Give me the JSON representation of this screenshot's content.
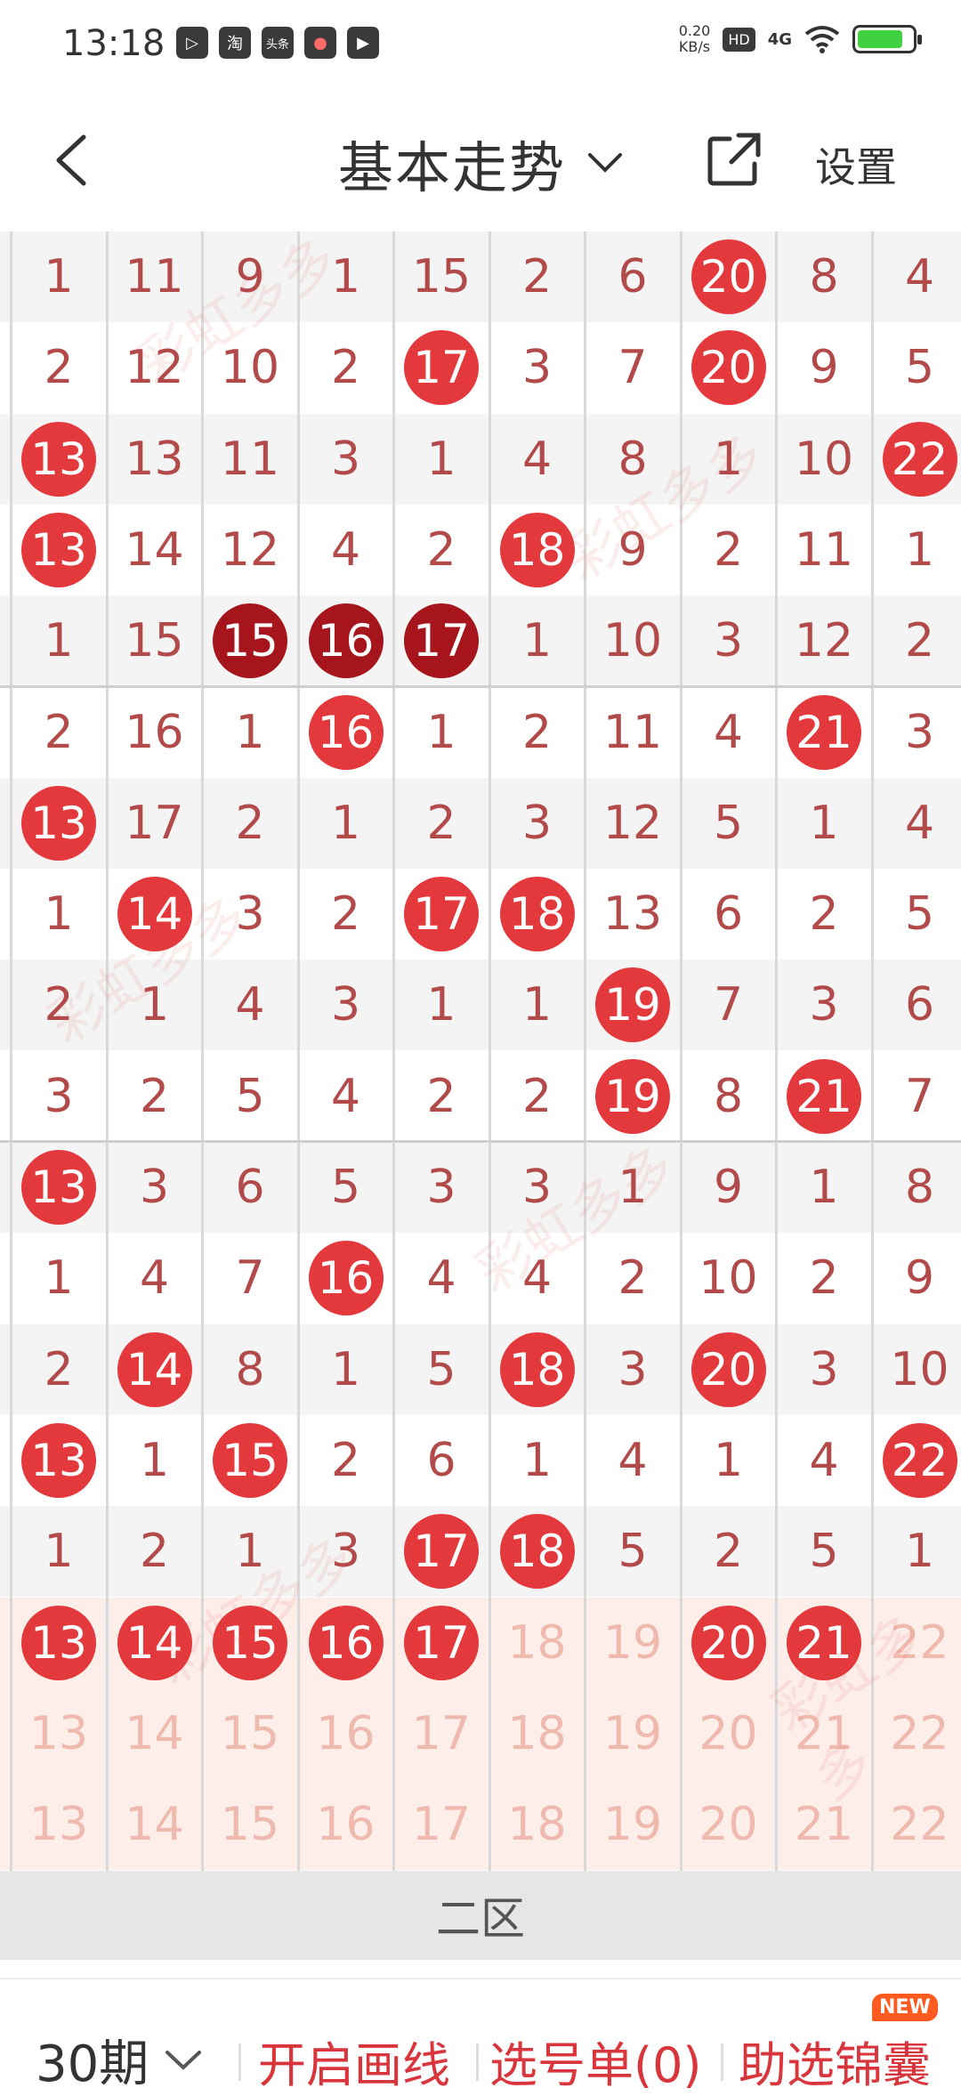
{
  "status_bar": {
    "time": "13:18",
    "apps": [
      "▷",
      "淘",
      "头条",
      "●",
      "▶"
    ],
    "net_speed": "0.20",
    "net_speed_unit": "KB/s",
    "hd_label": "HD",
    "network": "4G",
    "battery_level": 0.8,
    "battery_color": "#3fd13f"
  },
  "header": {
    "title": "基本走势",
    "settings_label": "设置"
  },
  "grid": {
    "partial_left_column": true,
    "rows": [
      {
        "cells": [
          "1",
          "11",
          "9",
          "1",
          "15",
          "2",
          "6",
          "20",
          "8",
          "4"
        ],
        "balls": [
          7
        ]
      },
      {
        "cells": [
          "2",
          "12",
          "10",
          "2",
          "17",
          "3",
          "7",
          "20",
          "9",
          "5"
        ],
        "balls": [
          4,
          7
        ]
      },
      {
        "cells": [
          "13",
          "13",
          "11",
          "3",
          "1",
          "4",
          "8",
          "1",
          "10",
          "22"
        ],
        "balls": [
          0,
          9
        ]
      },
      {
        "cells": [
          "13",
          "14",
          "12",
          "4",
          "2",
          "18",
          "9",
          "2",
          "11",
          "1"
        ],
        "balls": [
          0,
          5
        ]
      },
      {
        "cells": [
          "1",
          "15",
          "15",
          "16",
          "17",
          "1",
          "10",
          "3",
          "12",
          "2"
        ],
        "dark_balls": [
          2,
          3,
          4
        ]
      },
      {
        "cells": [
          "2",
          "16",
          "1",
          "16",
          "1",
          "2",
          "11",
          "4",
          "21",
          "3"
        ],
        "balls": [
          3,
          8
        ]
      },
      {
        "cells": [
          "13",
          "17",
          "2",
          "1",
          "2",
          "3",
          "12",
          "5",
          "1",
          "4"
        ],
        "balls": [
          0
        ]
      },
      {
        "cells": [
          "1",
          "14",
          "3",
          "2",
          "17",
          "18",
          "13",
          "6",
          "2",
          "5"
        ],
        "balls": [
          1,
          4,
          5
        ]
      },
      {
        "cells": [
          "2",
          "1",
          "4",
          "3",
          "1",
          "1",
          "19",
          "7",
          "3",
          "6"
        ],
        "balls": [
          6
        ]
      },
      {
        "cells": [
          "3",
          "2",
          "5",
          "4",
          "2",
          "2",
          "19",
          "8",
          "21",
          "7"
        ],
        "balls": [
          6,
          8
        ]
      },
      {
        "cells": [
          "13",
          "3",
          "6",
          "5",
          "3",
          "3",
          "1",
          "9",
          "1",
          "8"
        ],
        "balls": [
          0
        ]
      },
      {
        "cells": [
          "1",
          "4",
          "7",
          "16",
          "4",
          "4",
          "2",
          "10",
          "2",
          "9"
        ],
        "balls": [
          3
        ]
      },
      {
        "cells": [
          "2",
          "14",
          "8",
          "1",
          "5",
          "18",
          "3",
          "20",
          "3",
          "10"
        ],
        "balls": [
          1,
          5,
          7
        ]
      },
      {
        "cells": [
          "13",
          "1",
          "15",
          "2",
          "6",
          "1",
          "4",
          "1",
          "4",
          "22"
        ],
        "balls": [
          0,
          2,
          9
        ]
      },
      {
        "cells": [
          "1",
          "2",
          "1",
          "3",
          "17",
          "18",
          "5",
          "2",
          "5",
          "1"
        ],
        "balls": [
          4,
          5
        ]
      },
      {
        "cells": [
          "13",
          "14",
          "15",
          "16",
          "17",
          "18",
          "19",
          "20",
          "21",
          "22"
        ],
        "balls": [
          0,
          1,
          2,
          3,
          4,
          7,
          8
        ],
        "pale": true
      },
      {
        "cells": [
          "13",
          "14",
          "15",
          "16",
          "17",
          "18",
          "19",
          "20",
          "21",
          "22"
        ],
        "balls": [],
        "pale": true
      },
      {
        "cells": [
          "13",
          "14",
          "15",
          "16",
          "17",
          "18",
          "19",
          "20",
          "21",
          "22"
        ],
        "balls": [],
        "pale": true
      }
    ]
  },
  "zone_label": "二区",
  "bottom_bar": {
    "period_label": "30期",
    "draw_lines_label": "开启画线",
    "selection_list_label": "选号单(0)",
    "assistant_label": "助选锦囊",
    "new_badge": "NEW"
  },
  "watermark_text": "彩虹多多",
  "colors": {
    "ball_red": "#e4393c",
    "ball_dark": "#a5151b",
    "number_text": "#b24a4a",
    "accent_red": "#d9353c",
    "pale_row_bg": "#fdeee9",
    "alt_row_bg": "#f4f4f4"
  }
}
